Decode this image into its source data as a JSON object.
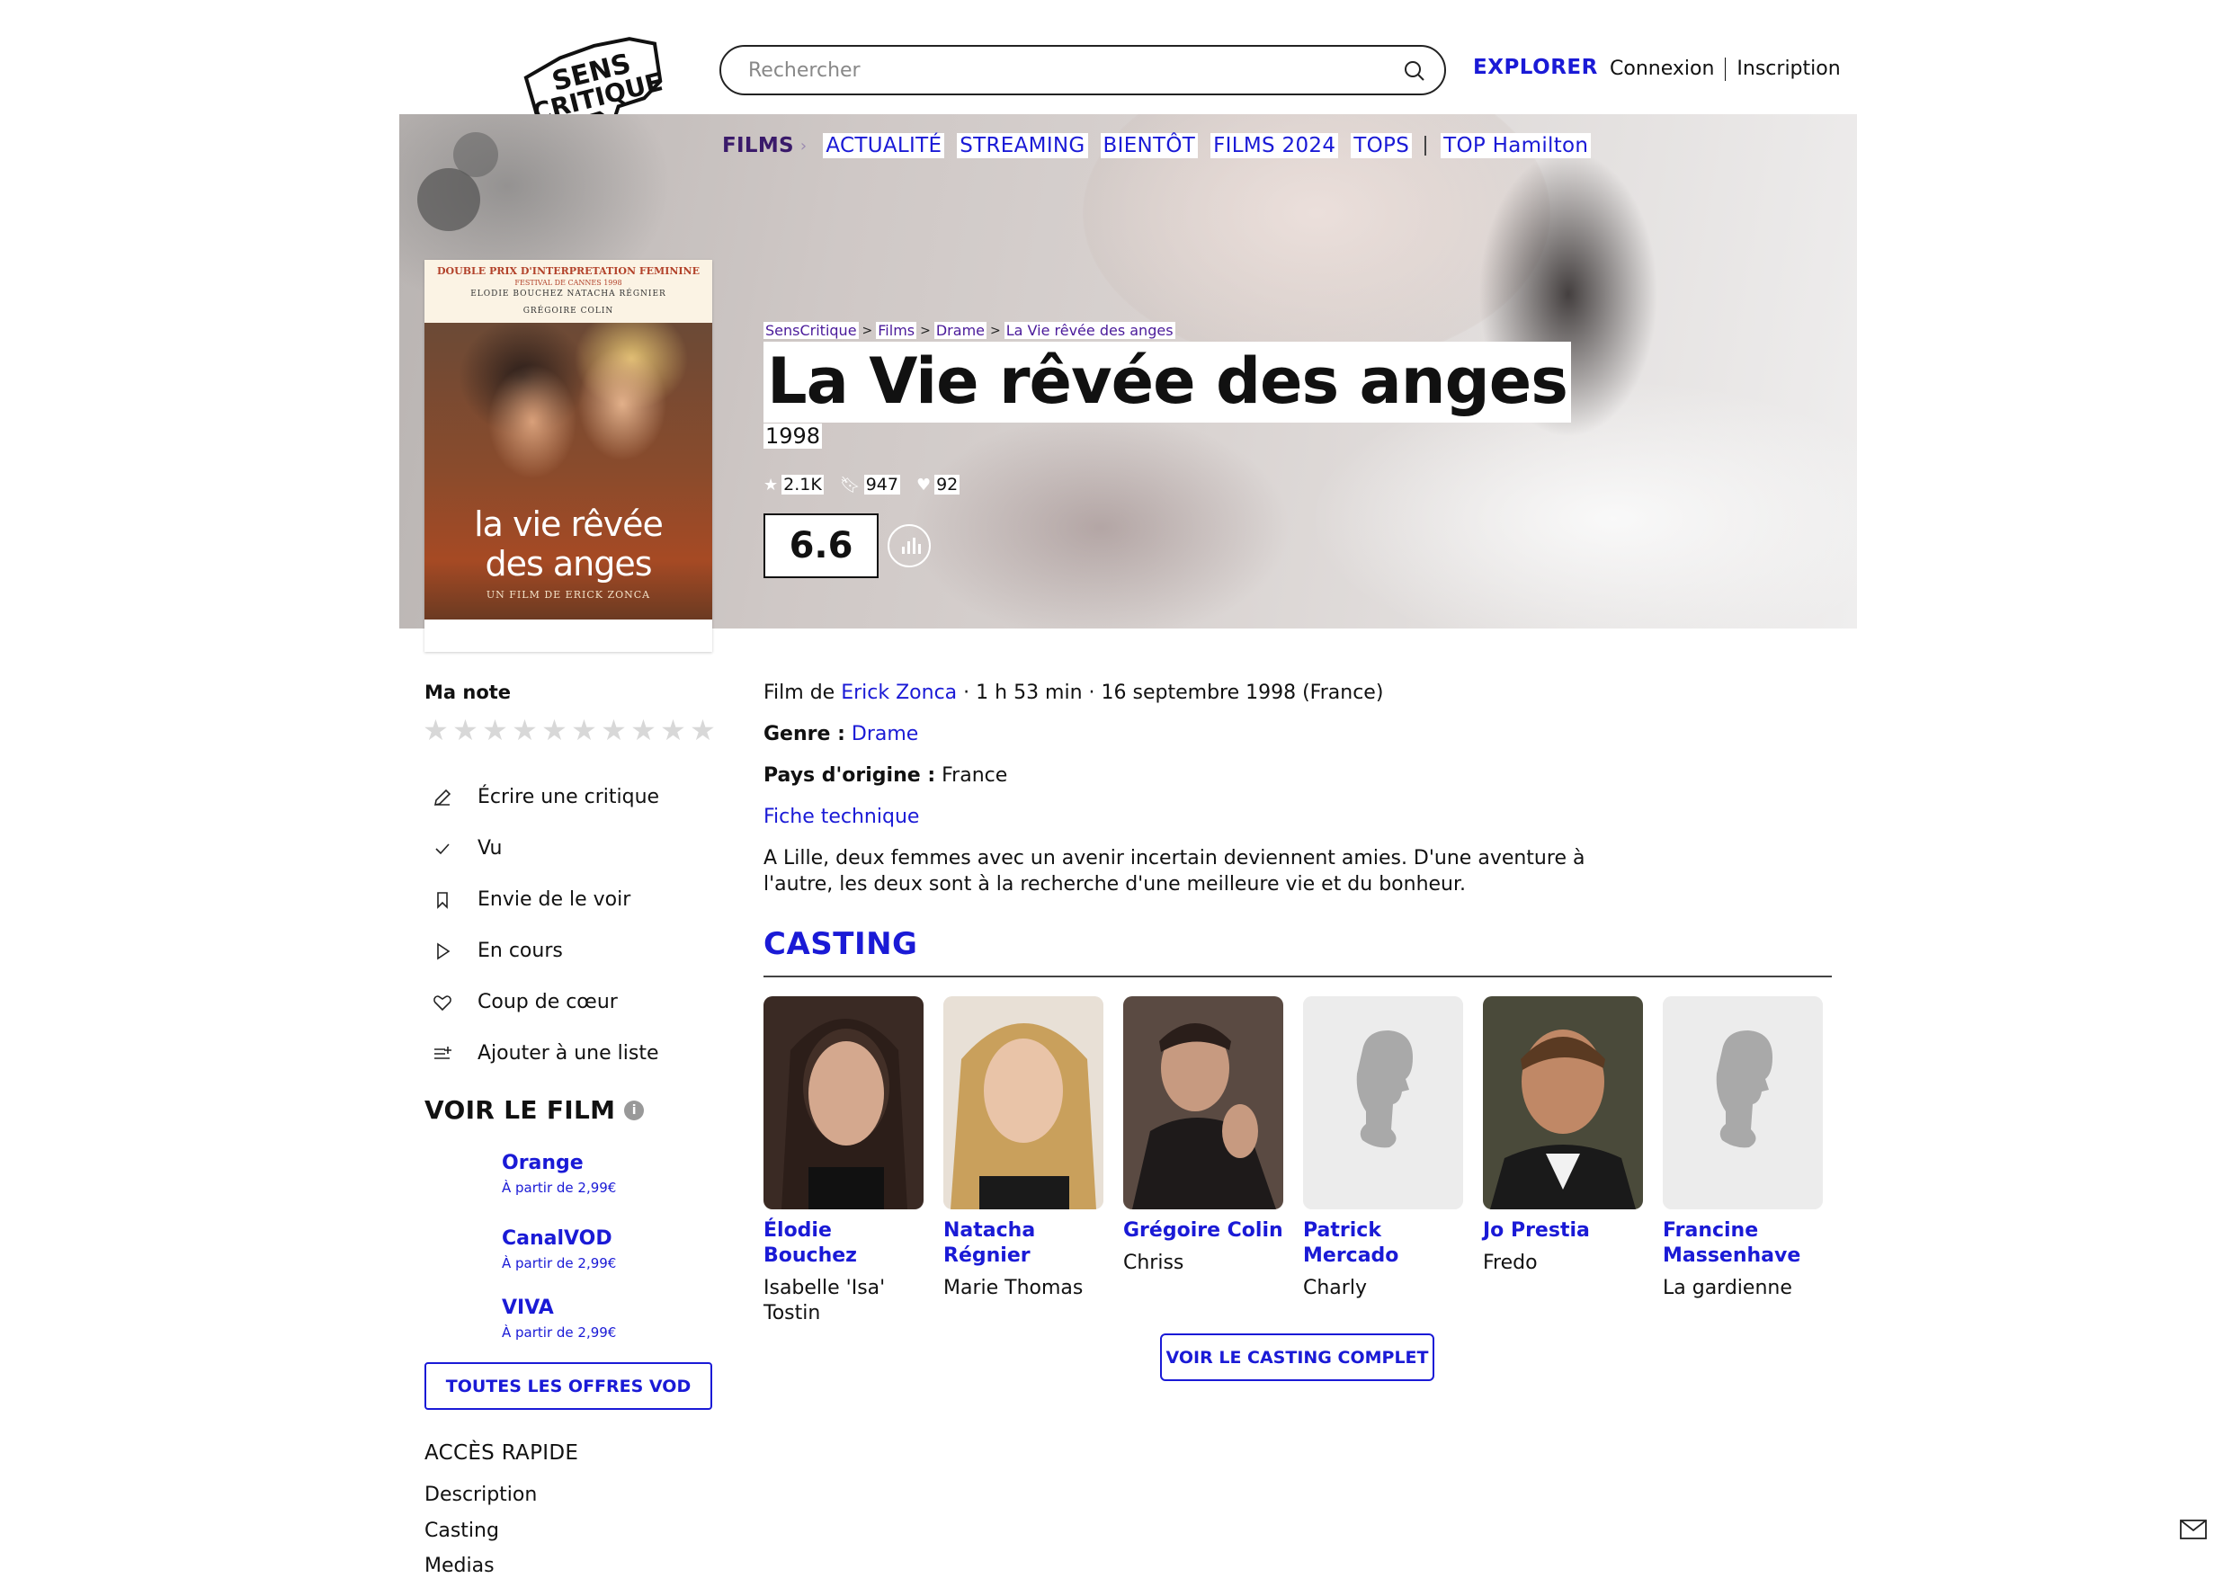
{
  "header": {
    "logo_line1": "SENS",
    "logo_line2": "CRITIQUE",
    "search_placeholder": "Rechercher",
    "explorer": "EXPLORER",
    "login": "Connexion",
    "signup": "Inscription"
  },
  "nav": {
    "active": "FILMS",
    "items": [
      "ACTUALITÉ",
      "STREAMING",
      "BIENTÔT",
      "FILMS 2024",
      "TOPS"
    ],
    "extra": "TOP Hamilton"
  },
  "poster": {
    "award": "DOUBLE PRIX D'INTERPRETATION FEMININE",
    "festival": "FESTIVAL DE CANNES 1998",
    "actors_line1": "ELODIE BOUCHEZ    NATACHA RÉGNIER",
    "actors_line2": "GRÉGOIRE COLIN",
    "title_line1": "la vie rêvée",
    "title_line2": "des anges",
    "director_line": "UN FILM DE ERICK ZONCA"
  },
  "breadcrumb": [
    "SensCritique",
    "Films",
    "Drame",
    "La Vie rêvée des anges"
  ],
  "film": {
    "title": "La Vie rêvée des anges",
    "year": "1998",
    "ratings_count": "2.1K",
    "wishlist_count": "947",
    "favorites_count": "92",
    "score": "6.6",
    "film_de_prefix": "Film de",
    "director": "Erick Zonca",
    "details_suffix": "· 1 h 53 min · 16 septembre 1998 (France)",
    "genre_label": "Genre :",
    "genre": "Drame",
    "country_label": "Pays d'origine :",
    "country": "France",
    "fiche_technique": "Fiche technique",
    "synopsis": "A Lille, deux femmes avec un avenir incertain deviennent amies. D'une aventure à l'autre, les deux sont à la recherche d'une meilleure vie et du bonheur."
  },
  "sidebar": {
    "ma_note": "Ma note",
    "actions": [
      {
        "label": "Écrire une critique",
        "icon": "pencil-icon"
      },
      {
        "label": "Vu",
        "icon": "check-icon"
      },
      {
        "label": "Envie de le voir",
        "icon": "bookmark-icon"
      },
      {
        "label": "En cours",
        "icon": "play-icon"
      },
      {
        "label": "Coup de cœur",
        "icon": "heart-icon"
      },
      {
        "label": "Ajouter à une liste",
        "icon": "list-add-icon"
      }
    ],
    "voir_le_film": "VOIR LE FILM",
    "vod": [
      {
        "name": "Orange",
        "price": "À partir de 2,99€"
      },
      {
        "name": "CanalVOD",
        "price": "À partir de 2,99€"
      },
      {
        "name": "VIVA",
        "price": "À partir de 2,99€"
      }
    ],
    "vod_button": "TOUTES LES OFFRES VOD",
    "acces_rapide": "ACCÈS RAPIDE",
    "quick_links": [
      "Description",
      "Casting",
      "Medias"
    ]
  },
  "casting": {
    "heading": "CASTING",
    "actors": [
      {
        "name": "Élodie Bouchez",
        "role": "Isabelle 'Isa' Tostin",
        "photo": "yes"
      },
      {
        "name": "Natacha Régnier",
        "role": "Marie Thomas",
        "photo": "yes"
      },
      {
        "name": "Grégoire Colin",
        "role": "Chriss",
        "photo": "yes"
      },
      {
        "name": "Patrick Mercado",
        "role": "Charly",
        "photo": "placeholder"
      },
      {
        "name": "Jo Prestia",
        "role": "Fredo",
        "photo": "yes"
      },
      {
        "name": "Francine Massenhave",
        "role": "La gardienne",
        "photo": "placeholder"
      }
    ],
    "button": "VOIR LE CASTING COMPLET"
  },
  "colors": {
    "accent": "#1a1ad6",
    "text": "#111111",
    "star_empty": "#d8d8d8"
  }
}
